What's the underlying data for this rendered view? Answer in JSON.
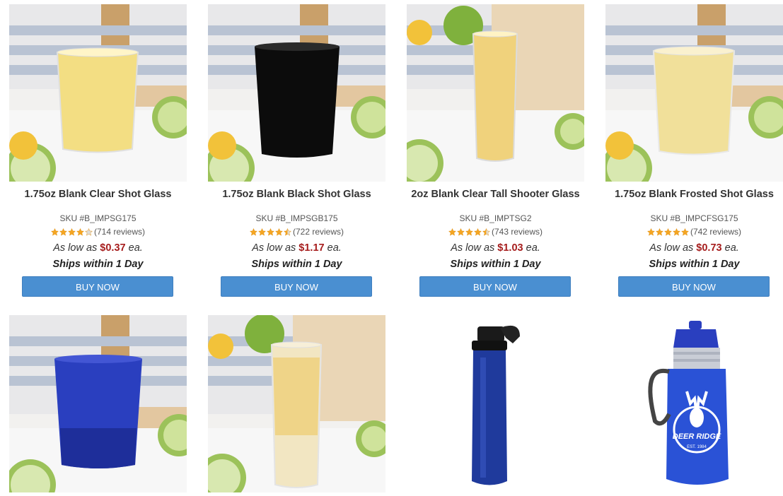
{
  "products": [
    {
      "title": "1.75oz Blank Clear Shot Glass",
      "sku": "SKU #B_IMPSG175",
      "rating": 4,
      "reviews": "(714 reviews)",
      "price_prefix": "As low as",
      "price": "$0.37",
      "price_suffix": "ea.",
      "ships": "Ships within 1 Day",
      "button": "BUY NOW"
    },
    {
      "title": "1.75oz Blank Black Shot Glass",
      "sku": "SKU #B_IMPSGB175",
      "rating": 4.5,
      "reviews": "(722 reviews)",
      "price_prefix": "As low as",
      "price": "$1.17",
      "price_suffix": "ea.",
      "ships": "Ships within 1 Day",
      "button": "BUY NOW"
    },
    {
      "title": "2oz Blank Clear Tall Shooter Glass",
      "sku": "SKU #B_IMPTSG2",
      "rating": 4.5,
      "reviews": "(743 reviews)",
      "price_prefix": "As low as",
      "price": "$1.03",
      "price_suffix": "ea.",
      "ships": "Ships within 1 Day",
      "button": "BUY NOW"
    },
    {
      "title": "1.75oz Blank Frosted Shot Glass",
      "sku": "SKU #B_IMPCFSG175",
      "rating": 5,
      "reviews": "(742 reviews)",
      "price_prefix": "As low as",
      "price": "$0.73",
      "price_suffix": "ea.",
      "ships": "Ships within 1 Day",
      "button": "BUY NOW"
    }
  ],
  "row2_images": [
    {
      "name": "blue-frosted-shot-glass-image",
      "logo_text": ""
    },
    {
      "name": "frosted-shooter-glass-image",
      "logo_text": ""
    },
    {
      "name": "blue-aluminum-water-bottle-image",
      "logo_text": ""
    },
    {
      "name": "blue-sport-bottle-image",
      "logo_text": "DEER RIDGE",
      "logo_sub": "EST. 1984"
    }
  ],
  "colors": {
    "price": "#a61d1d",
    "button": "#4a8fd1",
    "star": "#f5a623"
  }
}
